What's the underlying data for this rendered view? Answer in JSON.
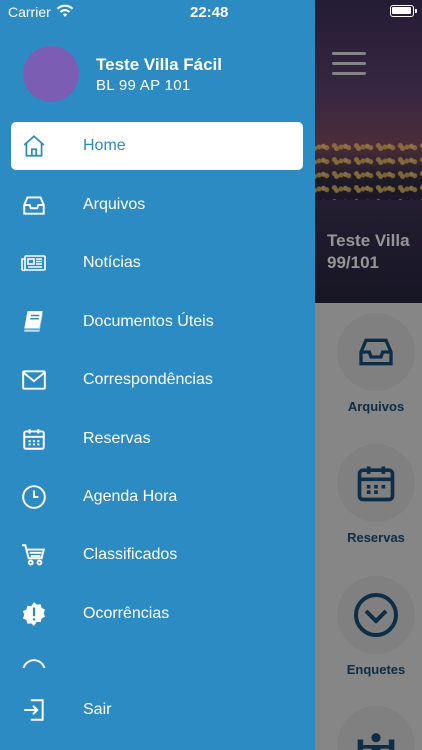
{
  "status_bar": {
    "carrier": "Carrier",
    "time": "22:48"
  },
  "user": {
    "name": "Teste Villa Fácil",
    "unit": "BL 99 AP 101"
  },
  "menu": [
    {
      "label": "Home",
      "icon": "home-icon",
      "active": true
    },
    {
      "label": "Arquivos",
      "icon": "inbox-icon"
    },
    {
      "label": "Notícias",
      "icon": "newspaper-icon"
    },
    {
      "label": "Documentos Úteis",
      "icon": "book-icon"
    },
    {
      "label": "Correspondências",
      "icon": "mail-icon"
    },
    {
      "label": "Reservas",
      "icon": "calendar-icon"
    },
    {
      "label": "Agenda Hora",
      "icon": "clock-icon"
    },
    {
      "label": "Classificados",
      "icon": "cart-icon"
    },
    {
      "label": "Ocorrências",
      "icon": "alert-icon"
    },
    {
      "label": "",
      "icon": "partial-icon"
    },
    {
      "label": "Sair",
      "icon": "logout-icon"
    }
  ],
  "background": {
    "hero_title_line1": "Teste Villa",
    "hero_title_line2": "99/101",
    "tiles": [
      {
        "label": "Arquivos",
        "icon": "inbox-icon"
      },
      {
        "label": "Reservas",
        "icon": "calendar-icon"
      },
      {
        "label": "Enquetes",
        "icon": "chevron-circle-icon"
      },
      {
        "label": "",
        "icon": "weight-icon"
      }
    ]
  },
  "colors": {
    "drawer": "#2d8bc3",
    "avatar": "#7b5db3",
    "tile_icon": "#174a72"
  }
}
